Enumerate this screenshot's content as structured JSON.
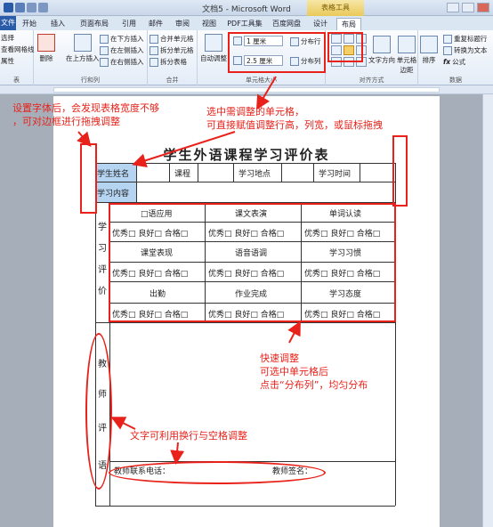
{
  "window": {
    "title": "文档5 - Microsoft Word",
    "context_tab_group": "表格工具"
  },
  "tabs": [
    "文件",
    "开始",
    "插入",
    "页面布局",
    "引用",
    "邮件",
    "审阅",
    "视图",
    "PDF工具集",
    "百度网盘",
    "设计",
    "布局"
  ],
  "active_tab": "布局",
  "ribbon": {
    "left_partial": [
      "选择",
      "查看网格线",
      "属性"
    ],
    "left_partial_group": "表",
    "delete_label": "删除",
    "insert_above": "在上方插入",
    "insert_below": "在下方插入",
    "insert_left": "在左侧插入",
    "insert_right": "在右侧插入",
    "rows_cols_group": "行和列",
    "merge_cells": "合并单元格",
    "split_cells": "拆分单元格",
    "split_table": "拆分表格",
    "merge_group": "合并",
    "autofit": "自动调整",
    "row_height_value": "1 厘米",
    "col_width_value": "2.5 厘米",
    "distribute_rows": "分布行",
    "distribute_cols": "分布列",
    "cell_size_group": "单元格大小",
    "text_direction": "文字方向",
    "cell_margins": "单元格边距",
    "alignment_group": "对齐方式",
    "sort": "排序",
    "repeat_header": "重复标题行",
    "convert_to_text": "转换为文本",
    "formula": "公式",
    "data_group": "数据"
  },
  "document": {
    "title": "学生外语课程学习评价表",
    "row1": [
      "学生姓名",
      "课程",
      "学习地点",
      "学习时间"
    ],
    "row2": "学习内容",
    "eval_label": "学习评价",
    "rating_text": "优秀□ 良好□ 合格□",
    "items": [
      [
        "□语应用",
        "课文表演",
        "单词认读"
      ],
      [
        "课堂表现",
        "语音语调",
        "学习习惯"
      ],
      [
        "出勤",
        "作业完成",
        "学习态度"
      ]
    ],
    "teacher_eval": "教师评语",
    "teacher_phone": "教师联系电话：",
    "teacher_sign": "教师签名："
  },
  "annotations": {
    "a1_line1": "设置字体后，会发现表格宽度不够",
    "a1_line2": "，可对边框进行拖拽调整",
    "a2_line1": "选中需调整的单元格，",
    "a2_line2": "可直接赋值调整行高，列宽，或鼠标拖拽",
    "a3_line1": "快速调整",
    "a3_line2": "可选中单元格后",
    "a3_line3": "点击“分布列”，均匀分布",
    "a4": "文字可利用换行与空格调整",
    "color": "#e8221a"
  }
}
